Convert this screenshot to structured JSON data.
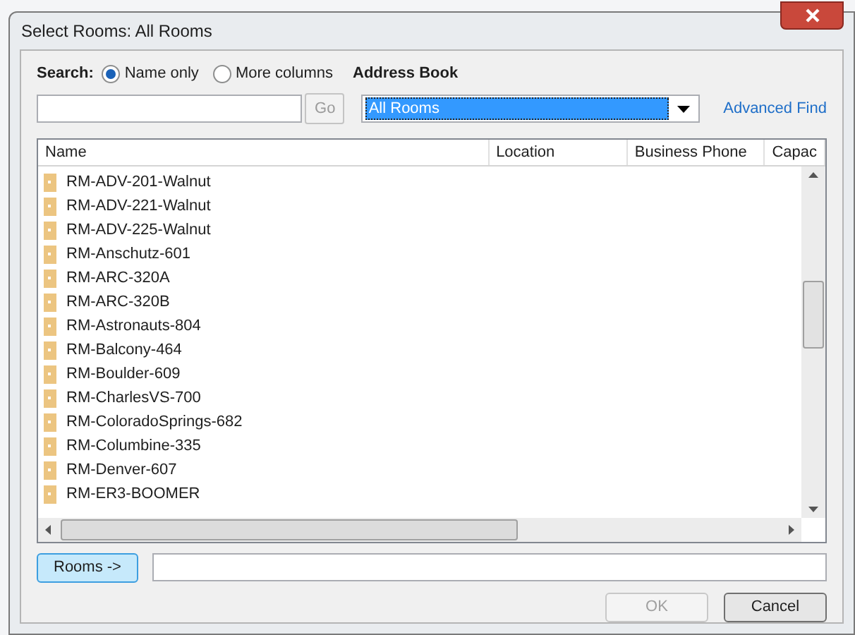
{
  "window": {
    "title": "Select Rooms: All Rooms"
  },
  "search": {
    "label": "Search:",
    "options": [
      {
        "label": "Name only",
        "selected": true
      },
      {
        "label": "More columns",
        "selected": false
      }
    ],
    "go_button": {
      "label": "Go",
      "disabled": true
    }
  },
  "address_book": {
    "label": "Address Book",
    "value": "All Rooms",
    "advanced_find": "Advanced Find"
  },
  "table": {
    "columns": [
      "Name",
      "Location",
      "Business Phone",
      "Capac"
    ],
    "rows": [
      "RM-ADV-201-Walnut",
      "RM-ADV-221-Walnut",
      "RM-ADV-225-Walnut",
      "RM-Anschutz-601",
      "RM-ARC-320A",
      "RM-ARC-320B",
      "RM-Astronauts-804",
      "RM-Balcony-464",
      "RM-Boulder-609",
      "RM-CharlesVS-700",
      "RM-ColoradoSprings-682",
      "RM-Columbine-335",
      "RM-Denver-607",
      "RM-ER3-BOOMER"
    ]
  },
  "rooms_button": {
    "label": "Rooms ->"
  },
  "buttons": [
    {
      "label": "OK",
      "disabled": true
    },
    {
      "label": "Cancel",
      "disabled": false
    }
  ]
}
